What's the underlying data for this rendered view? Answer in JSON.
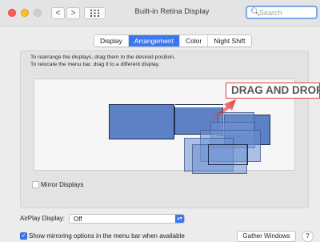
{
  "window": {
    "title": "Built-in Retina Display",
    "back_label": "<",
    "forward_label": ">",
    "grid_label": "⋯"
  },
  "search": {
    "placeholder": "Search"
  },
  "tabs": [
    {
      "label": "Display",
      "active": false
    },
    {
      "label": "Arrangement",
      "active": true
    },
    {
      "label": "Color",
      "active": false
    },
    {
      "label": "Night Shift",
      "active": false
    }
  ],
  "instructions": {
    "line1": "To rearrange the displays, drag them to the desired position.",
    "line2": "To relocate the menu bar, drag it to a different display."
  },
  "overlay": {
    "label": "DRAG AND DROP",
    "color": "#e43b3b"
  },
  "mirror": {
    "label": "Mirror Displays",
    "checked": false
  },
  "airplay": {
    "label": "AirPlay Display:",
    "value": "Off"
  },
  "show_mirroring": {
    "label": "Show mirroring options in the menu bar when available",
    "checked": true
  },
  "buttons": {
    "gather": "Gather Windows",
    "help": "?"
  },
  "colors": {
    "accent": "#3a78f2",
    "display_fill": "#5c82c5"
  }
}
